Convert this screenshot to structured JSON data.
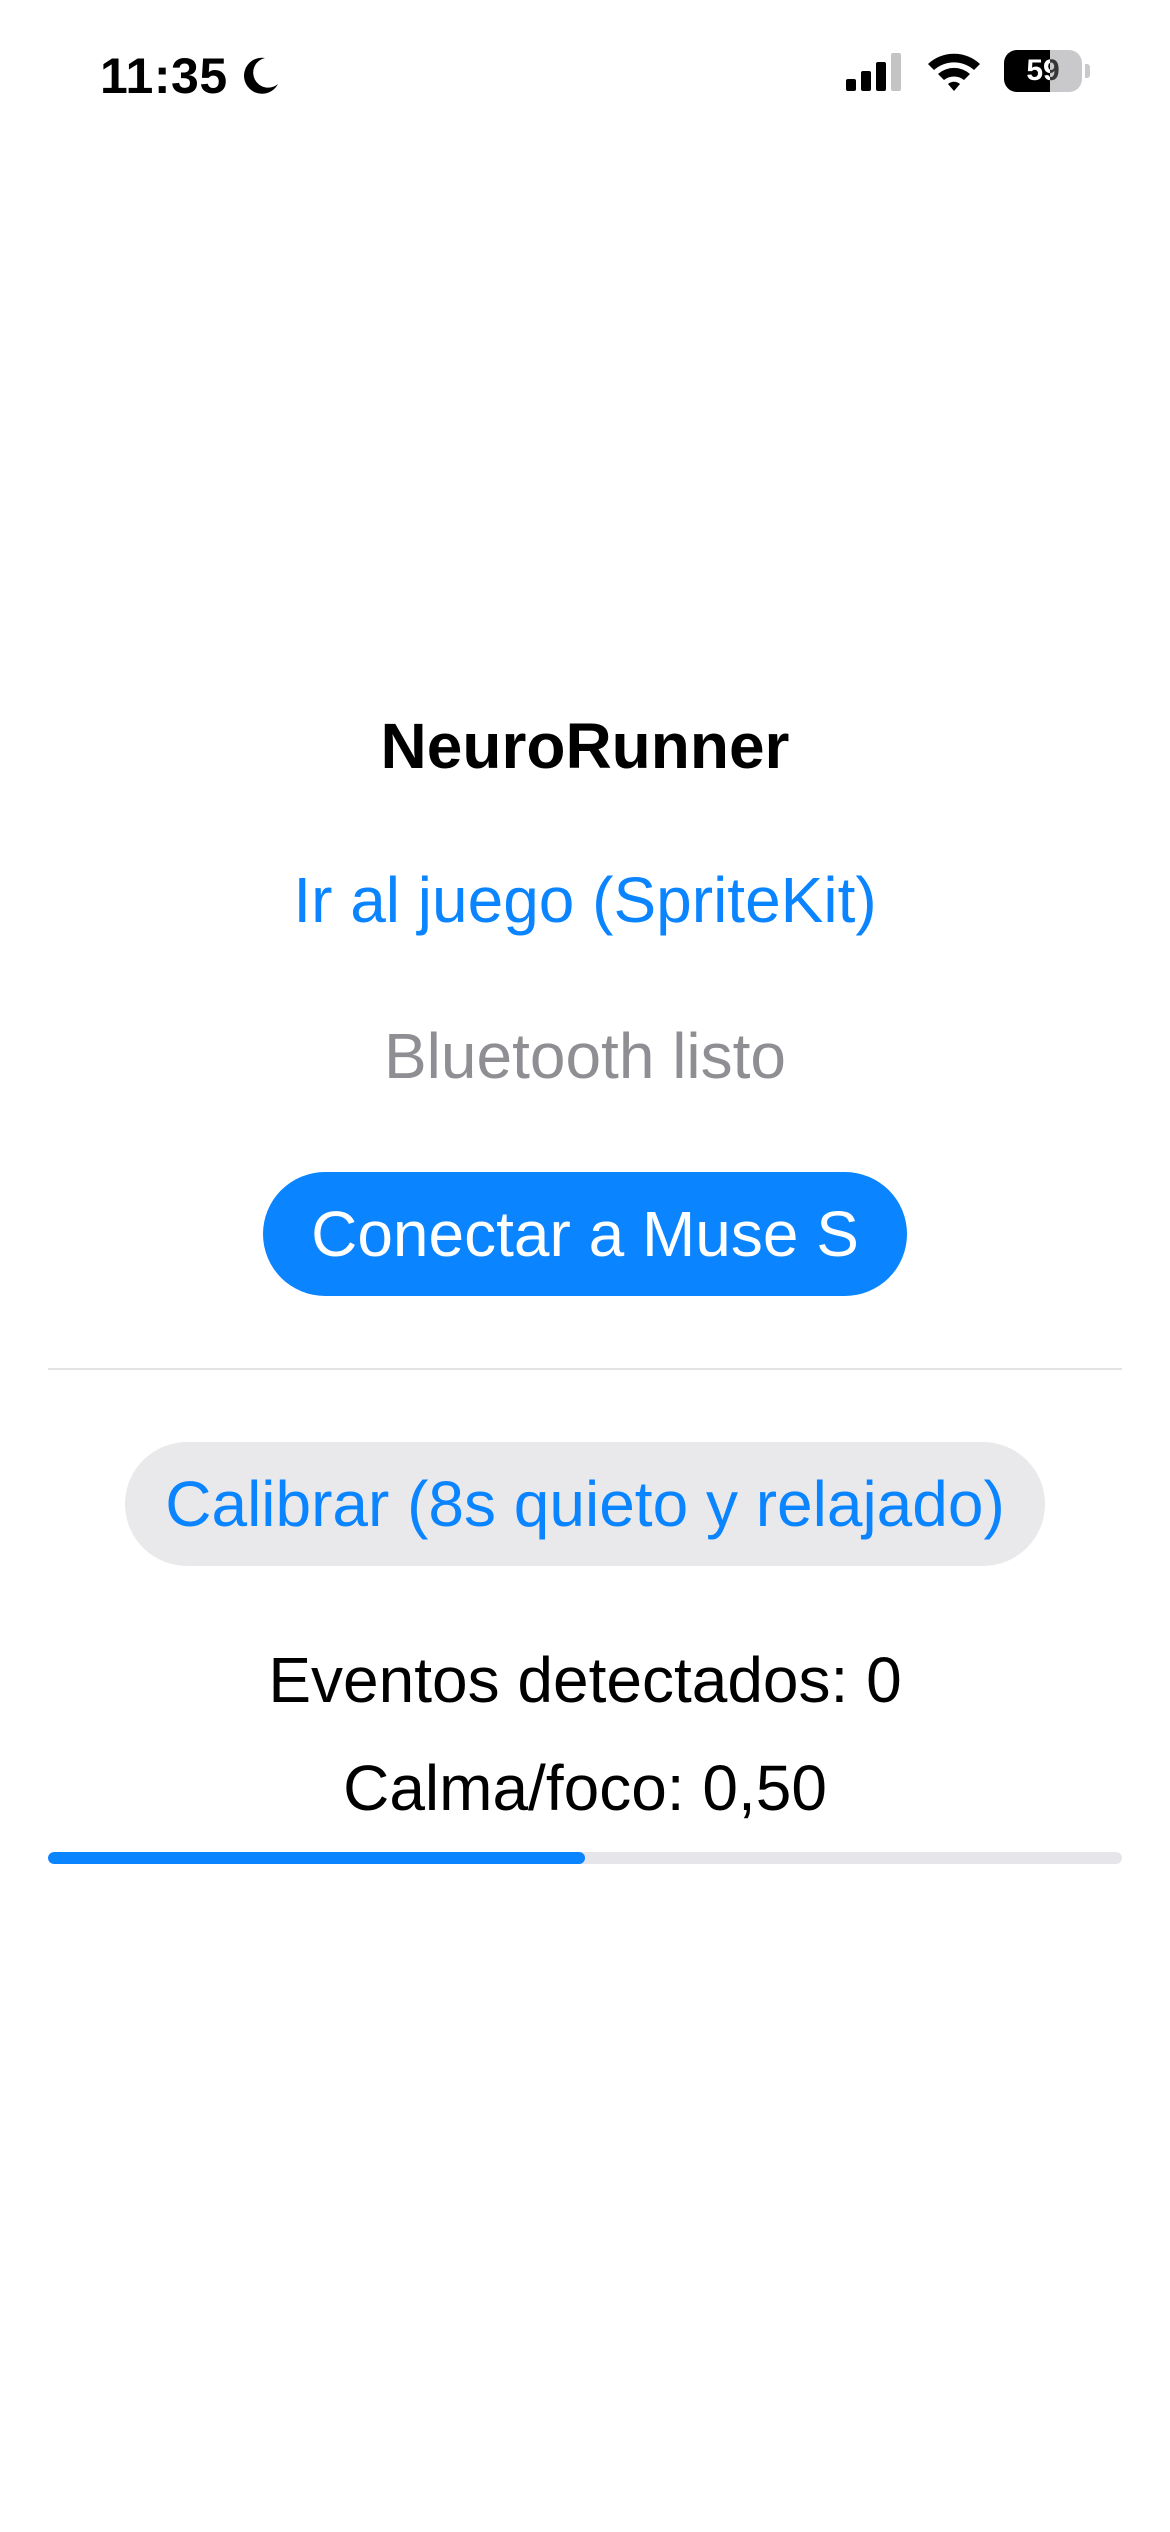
{
  "status_bar": {
    "time": "11:35",
    "battery_level": "59",
    "battery_fraction": 0.59,
    "icons": [
      "moon-icon",
      "signal-icon",
      "wifi-icon",
      "battery-icon"
    ]
  },
  "app": {
    "title": "NeuroRunner",
    "game_link_label": "Ir al juego (SpriteKit)",
    "bluetooth_status": "Bluetooth listo",
    "connect_button_label": "Conectar a Muse S",
    "calibrate_button_label": "Calibrar (8s quieto y relajado)",
    "events_label": "Eventos detectados: 0",
    "calm_focus_label": "Calma/foco: 0,50",
    "calm_focus_value": 0.5
  },
  "colors": {
    "accent": "#0a84ff",
    "secondary_text": "#8e8e93",
    "secondary_button_bg": "#e9e9eb",
    "track": "#e5e5ea"
  }
}
